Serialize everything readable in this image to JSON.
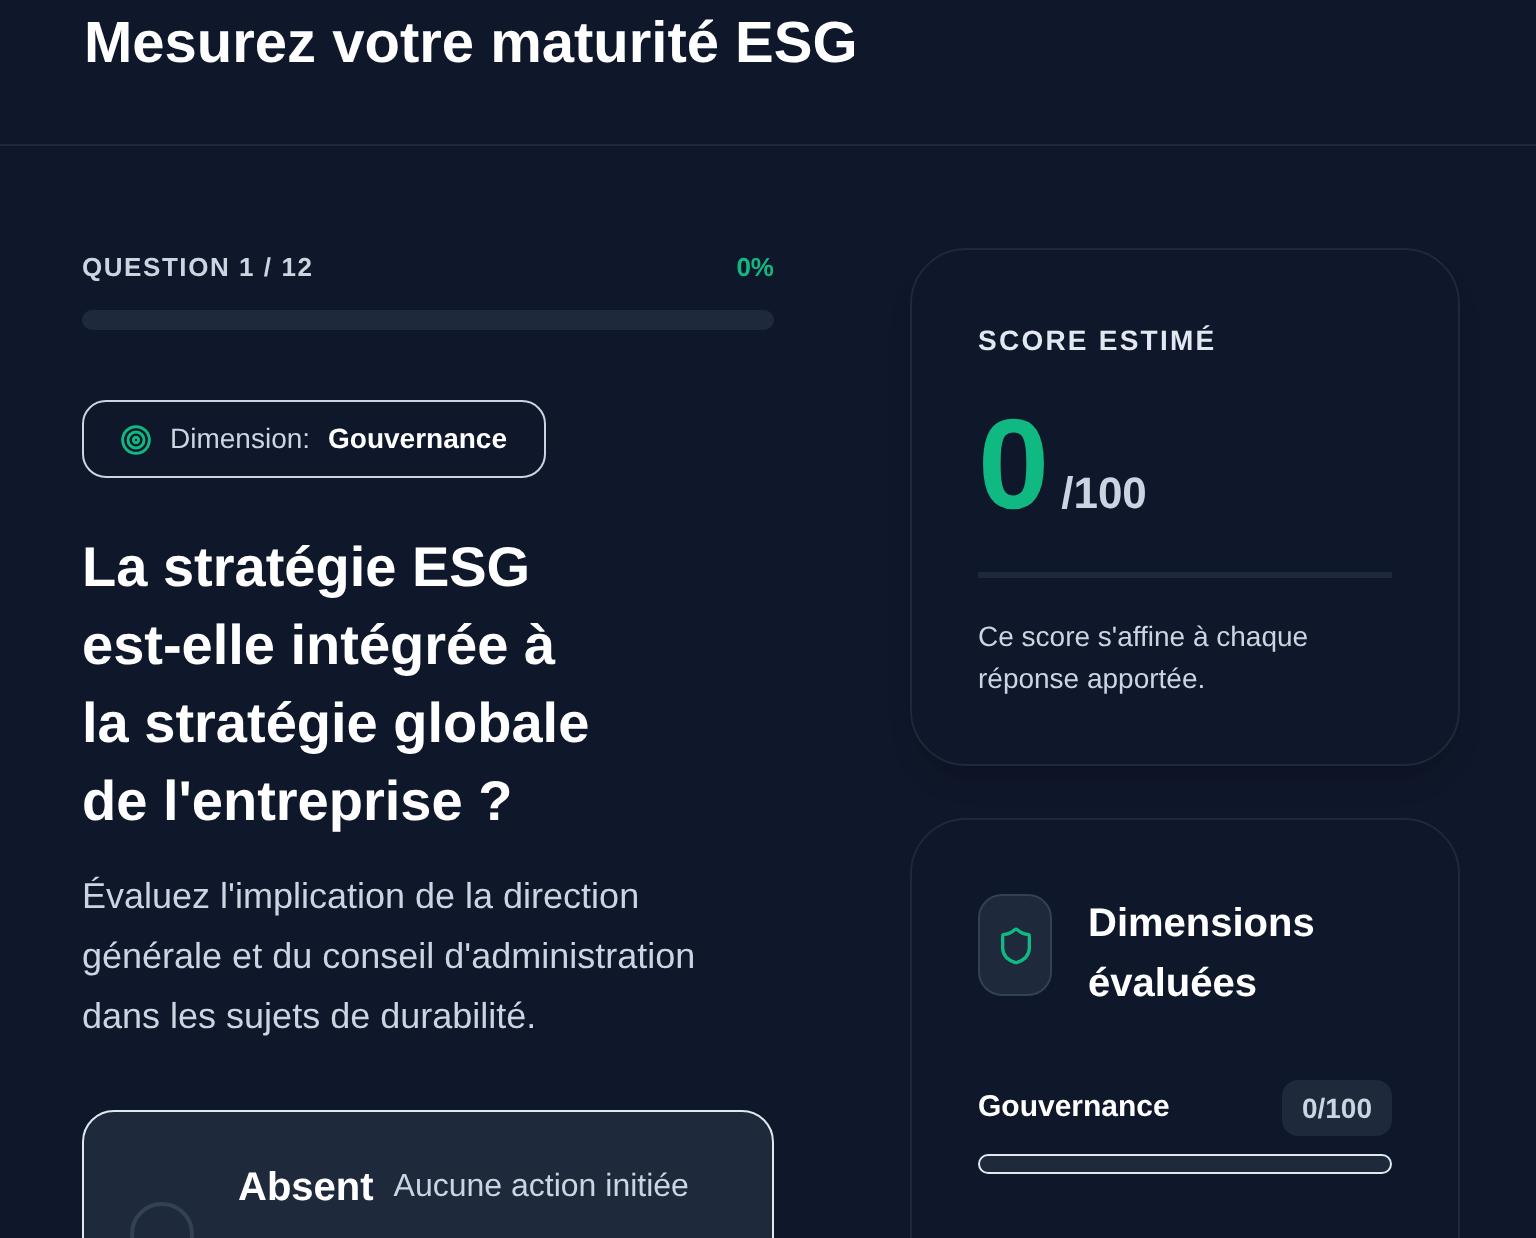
{
  "header": {
    "title": "Mesurez votre maturité ESG"
  },
  "progress": {
    "label": "QUESTION 1 / 12",
    "percent": "0%",
    "level": 0
  },
  "dimension_chip": {
    "label": "Dimension:",
    "value": "Gouvernance"
  },
  "question": {
    "title": "La stratégie ESG est-elle intégrée à la stratégie globale de l'entreprise ?",
    "description": "Évaluez l'implication de la direction générale et du conseil d'administration dans les sujets de durabilité."
  },
  "options": [
    {
      "label": "Absent",
      "description": "Aucune action initiée",
      "selected": false
    }
  ],
  "score_card": {
    "title": "SCORE ESTIMÉ",
    "score": "0",
    "max": "/100",
    "note": "Ce score s'affine à chaque réponse apportée."
  },
  "dimensions_card": {
    "title": "Dimensions évaluées",
    "items": [
      {
        "name": "Gouvernance",
        "score": "0/100",
        "level": 0
      }
    ]
  }
}
